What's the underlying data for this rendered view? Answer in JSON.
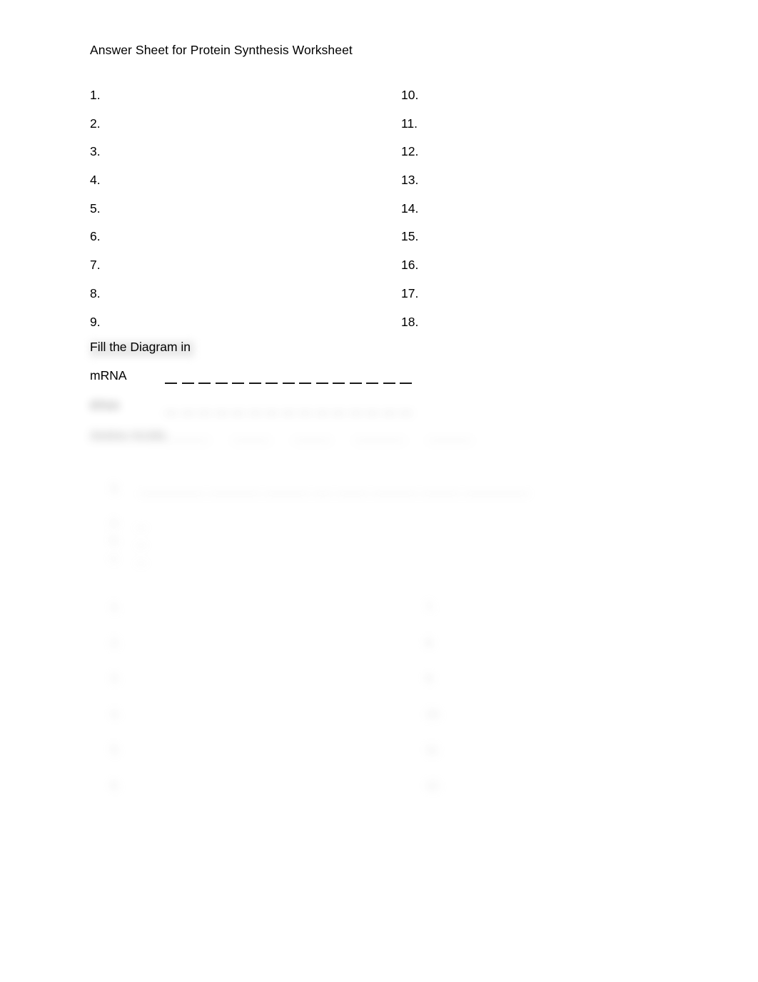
{
  "document": {
    "title": "Answer Sheet for Protein Synthesis Worksheet"
  },
  "answers": {
    "left_column": [
      "1.",
      "2.",
      "3.",
      "4.",
      "5.",
      "6.",
      "7.",
      "8.",
      "9."
    ],
    "right_column": [
      "10.",
      "11.",
      "12.",
      "13.",
      "14.",
      "15.",
      "16.",
      "17.",
      "18."
    ]
  },
  "diagram_section": {
    "heading": "Fill the Diagram in",
    "rows": [
      {
        "label": "mRNA",
        "blank_count": 15,
        "legible": true
      },
      {
        "label": "tRNA",
        "blank_count": 15,
        "legible": false
      },
      {
        "label": "Amino Acids",
        "blank_count": 0,
        "legible": false,
        "words": [
          "_______",
          "______",
          "______",
          "________",
          "_______"
        ]
      }
    ]
  },
  "faded_question": {
    "number": "1.",
    "text": "__________ ________ _______ ___ _____ _______ ______ __________"
  },
  "faded_options": [
    {
      "key": "a.",
      "text": "__"
    },
    {
      "key": "b.",
      "text": "__"
    },
    {
      "key": "c.",
      "text": "__"
    }
  ],
  "faded_list": {
    "left_column": [
      "1.",
      "2.",
      "3.",
      "4.",
      "5.",
      "6."
    ],
    "right_column": [
      "7.",
      "8.",
      "9.",
      "10.",
      "11.",
      "12."
    ]
  }
}
